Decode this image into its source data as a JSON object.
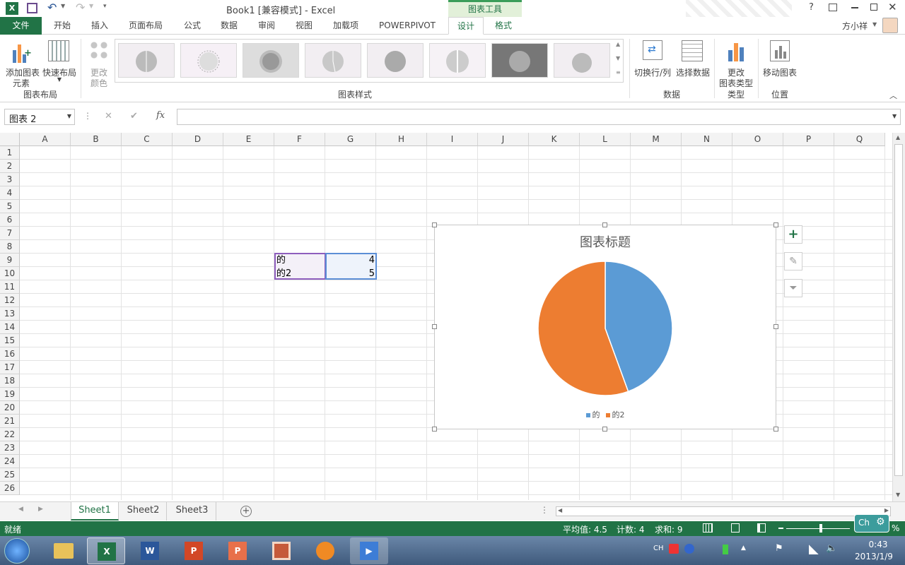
{
  "app": {
    "title": "Book1  [兼容模式] - Excel",
    "help": "?",
    "user": "方小祥"
  },
  "tabs": {
    "file": "文件",
    "items": [
      "开始",
      "插入",
      "页面布局",
      "公式",
      "数据",
      "审阅",
      "视图",
      "加载项",
      "POWERPIVOT",
      "设计",
      "格式"
    ],
    "tool_label": "图表工具"
  },
  "ribbon": {
    "add_element": [
      "添加图表",
      "元素"
    ],
    "quick_layout": "快速布局",
    "change_color": [
      "更改",
      "颜色"
    ],
    "group_layout": "图表布局",
    "group_styles": "图表样式",
    "switch_rowcol": "切换行/列",
    "select_data": "选择数据",
    "group_data": "数据",
    "change_type": [
      "更改",
      "图表类型"
    ],
    "group_type": "类型",
    "move_chart": "移动图表",
    "group_location": "位置"
  },
  "formula": {
    "namebox": "图表 2",
    "cancel": "✕",
    "enter": "✔",
    "fx": "fx",
    "value": ""
  },
  "columns": [
    "A",
    "B",
    "C",
    "D",
    "E",
    "F",
    "G",
    "H",
    "I",
    "J",
    "K",
    "L",
    "M",
    "N",
    "O",
    "P",
    "Q"
  ],
  "rows": [
    "1",
    "2",
    "3",
    "4",
    "5",
    "6",
    "7",
    "8",
    "9",
    "10",
    "11",
    "12",
    "13",
    "14",
    "15",
    "16",
    "17",
    "18",
    "19",
    "20",
    "21",
    "22",
    "23",
    "24",
    "25",
    "26"
  ],
  "cells": {
    "F9": "的",
    "G9": "4",
    "F10": "的2",
    "G10": "5"
  },
  "chart_data": {
    "type": "pie",
    "title": "图表标题",
    "categories": [
      "的",
      "的2"
    ],
    "values": [
      4,
      5
    ],
    "colors": [
      "#5b9bd5",
      "#ed7d31"
    ],
    "legend": "bottom"
  },
  "sheets": {
    "tabs": [
      "Sheet1",
      "Sheet2",
      "Sheet3"
    ],
    "active": "Sheet1",
    "add": "+"
  },
  "status": {
    "ready": "就绪",
    "average": "平均值: 4.5",
    "count": "计数: 4",
    "sum": "求和: 9",
    "zoom": "%",
    "ime": "Ch"
  },
  "taskbar": {
    "time": "0:43",
    "date": "2013/1/9",
    "lang": "CH"
  },
  "colors": {
    "excel_green": "#217346",
    "tool_green": "#e2f0d9"
  }
}
